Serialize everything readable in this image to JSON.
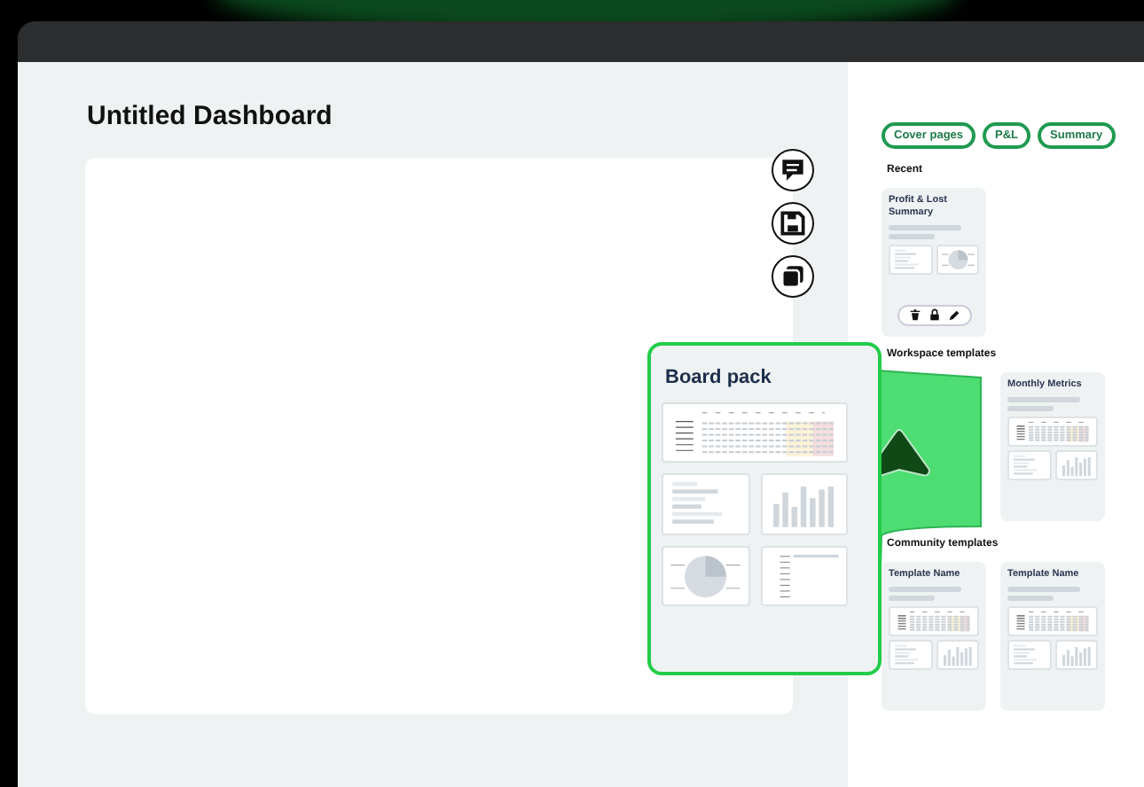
{
  "title": "Untitled Dashboard",
  "canvas_actions": [
    {
      "kind": "comment"
    },
    {
      "kind": "save"
    },
    {
      "kind": "copy"
    }
  ],
  "filters": [
    {
      "label": "Cover pages"
    },
    {
      "label": "P&L"
    },
    {
      "label": "Summary"
    }
  ],
  "recent": {
    "heading": "Recent",
    "cards": [
      {
        "title": "Profit & Lost Summary",
        "thumbs": [
          {
            "kind": "bar"
          },
          {
            "kind": "pie"
          }
        ],
        "actions": [
          {
            "kind": "delete"
          },
          {
            "kind": "lock"
          },
          {
            "kind": "edit"
          }
        ]
      }
    ]
  },
  "workspace": {
    "heading": "Workspace templates",
    "cards": [
      {
        "title": "Monthly Metrics",
        "thumbs": [
          {
            "kind": "table"
          },
          {
            "kind": "bar"
          },
          {
            "kind": "column"
          }
        ]
      }
    ]
  },
  "community": {
    "heading": "Community templates",
    "cards": [
      {
        "title": "Template Name",
        "thumbs": [
          {
            "kind": "table"
          },
          {
            "kind": "bar"
          },
          {
            "kind": "column"
          }
        ]
      },
      {
        "title": "Template Name",
        "thumbs": [
          {
            "kind": "table"
          },
          {
            "kind": "bar"
          },
          {
            "kind": "column"
          }
        ]
      }
    ]
  },
  "preview": {
    "title": "Board pack",
    "thumbs": [
      {
        "kind": "table"
      },
      {
        "kind": "bar"
      },
      {
        "kind": "column"
      },
      {
        "kind": "pie"
      },
      {
        "kind": "list"
      }
    ]
  }
}
